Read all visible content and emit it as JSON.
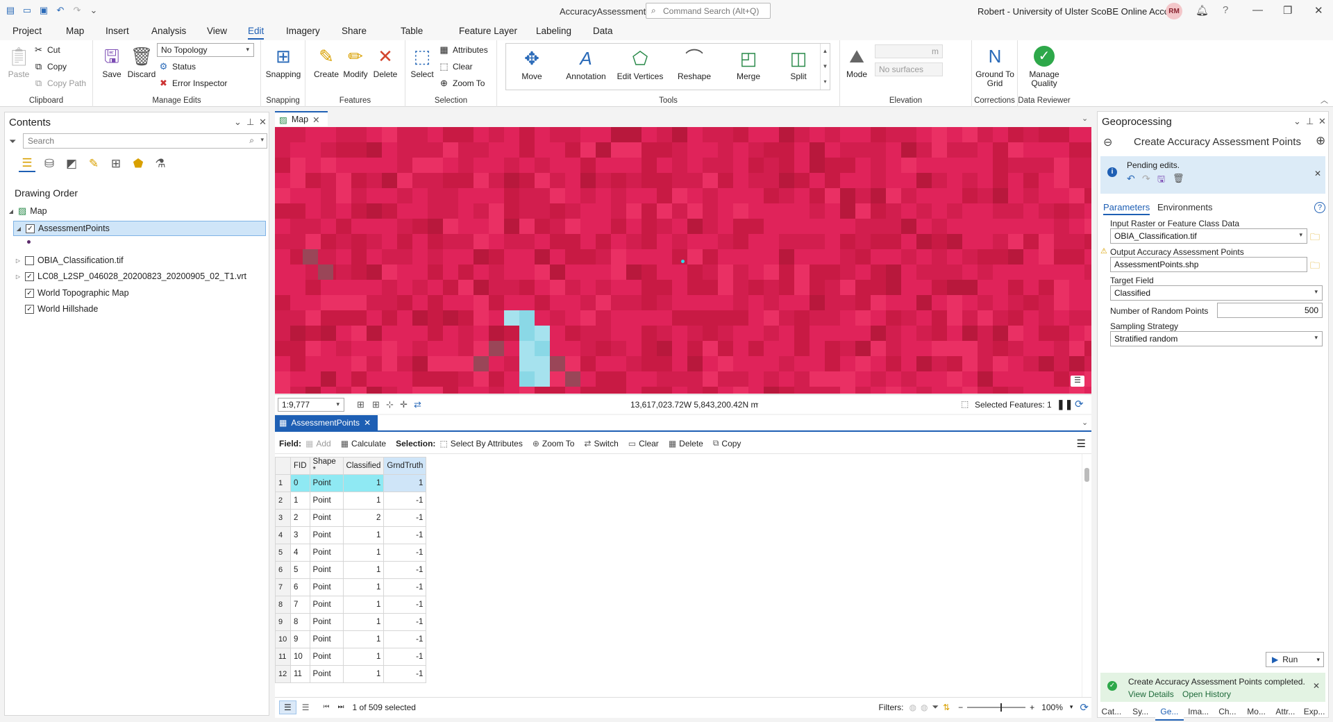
{
  "app_title": "AccuracyAssessment",
  "command_search_placeholder": "Command Search (Alt+Q)",
  "account": "Robert - University of Ulster ScoBE Online Account",
  "avatar_initials": "RM",
  "ribbon_tabs": [
    "Project",
    "Map",
    "Insert",
    "Analysis",
    "View",
    "Edit",
    "Imagery",
    "Share",
    "Table",
    "Feature Layer",
    "Labeling",
    "Data"
  ],
  "active_tab": "Edit",
  "clipboard": {
    "paste": "Paste",
    "cut": "Cut",
    "copy": "Copy",
    "copy_path": "Copy Path",
    "label": "Clipboard"
  },
  "manage_edits": {
    "save": "Save",
    "discard": "Discard",
    "topology": "No Topology",
    "status": "Status",
    "error_inspector": "Error Inspector",
    "label": "Manage Edits"
  },
  "snapping": {
    "button": "Snapping",
    "label": "Snapping"
  },
  "features": {
    "create": "Create",
    "modify": "Modify",
    "delete": "Delete",
    "label": "Features"
  },
  "selection": {
    "select": "Select",
    "attributes": "Attributes",
    "clear": "Clear",
    "zoom_to": "Zoom To",
    "label": "Selection"
  },
  "tools": {
    "items": [
      "Move",
      "Annotation",
      "Edit Vertices",
      "Reshape",
      "Merge",
      "Split"
    ],
    "label": "Tools"
  },
  "elevation": {
    "mode": "Mode",
    "unit": "m",
    "surface": "No surfaces",
    "label": "Elevation"
  },
  "corrections": {
    "ground_to_grid": "Ground To Grid",
    "label": "Corrections"
  },
  "data_reviewer": {
    "manage_quality": "Manage Quality",
    "label": "Data Reviewer"
  },
  "contents": {
    "title": "Contents",
    "search_placeholder": "Search",
    "drawing_order": "Drawing Order",
    "map": "Map",
    "layers": [
      {
        "name": "AssessmentPoints",
        "checked": true,
        "selected": true
      },
      {
        "name": "OBIA_Classification.tif",
        "checked": false
      },
      {
        "name": "LC08_L2SP_046028_20200823_20200905_02_T1.vrt",
        "checked": true
      },
      {
        "name": "World Topographic Map",
        "checked": true
      },
      {
        "name": "World Hillshade",
        "checked": true
      }
    ]
  },
  "map_view": {
    "tab": "Map",
    "scale": "1:9,777",
    "coordinates": "13,617,023.72W 5,843,200.42N m",
    "selected_features": "Selected Features: 1"
  },
  "table_view": {
    "tab": "AssessmentPoints",
    "field_label": "Field:",
    "add": "Add",
    "calculate": "Calculate",
    "selection_label": "Selection:",
    "select_by_attributes": "Select By Attributes",
    "zoom_to": "Zoom To",
    "switch": "Switch",
    "clear": "Clear",
    "delete": "Delete",
    "copy": "Copy",
    "columns": [
      "FID",
      "Shape *",
      "Classified",
      "GrndTruth"
    ],
    "rows": [
      [
        1,
        0,
        "Point",
        1,
        1
      ],
      [
        2,
        1,
        "Point",
        1,
        -1
      ],
      [
        3,
        2,
        "Point",
        2,
        -1
      ],
      [
        4,
        3,
        "Point",
        1,
        -1
      ],
      [
        5,
        4,
        "Point",
        1,
        -1
      ],
      [
        6,
        5,
        "Point",
        1,
        -1
      ],
      [
        7,
        6,
        "Point",
        1,
        -1
      ],
      [
        8,
        7,
        "Point",
        1,
        -1
      ],
      [
        9,
        8,
        "Point",
        1,
        -1
      ],
      [
        10,
        9,
        "Point",
        1,
        -1
      ],
      [
        11,
        10,
        "Point",
        1,
        -1
      ],
      [
        12,
        11,
        "Point",
        1,
        -1
      ]
    ],
    "status": "1 of 509 selected",
    "filters": "Filters:",
    "zoom": "100%"
  },
  "geoprocessing": {
    "title": "Geoprocessing",
    "tool": "Create Accuracy Assessment Points",
    "message": "Pending edits.",
    "tab_parameters": "Parameters",
    "tab_environments": "Environments",
    "input_label": "Input Raster or Feature Class Data",
    "input_value": "OBIA_Classification.tif",
    "output_label": "Output Accuracy Assessment Points",
    "output_value": "AssessmentPoints.shp",
    "target_label": "Target Field",
    "target_value": "Classified",
    "num_label": "Number of Random Points",
    "num_value": "500",
    "strategy_label": "Sampling Strategy",
    "strategy_value": "Stratified random",
    "run": "Run",
    "completed": "Create Accuracy Assessment Points completed.",
    "view_details": "View Details",
    "open_history": "Open History"
  },
  "bottom_tabs": [
    "Cat...",
    "Sy...",
    "Ge...",
    "Ima...",
    "Ch...",
    "Mo...",
    "Attr...",
    "Exp..."
  ],
  "colors": {
    "accent": "#1e5fb4",
    "map_red": "#dc2050",
    "selected_row": "#8fe9f3"
  }
}
